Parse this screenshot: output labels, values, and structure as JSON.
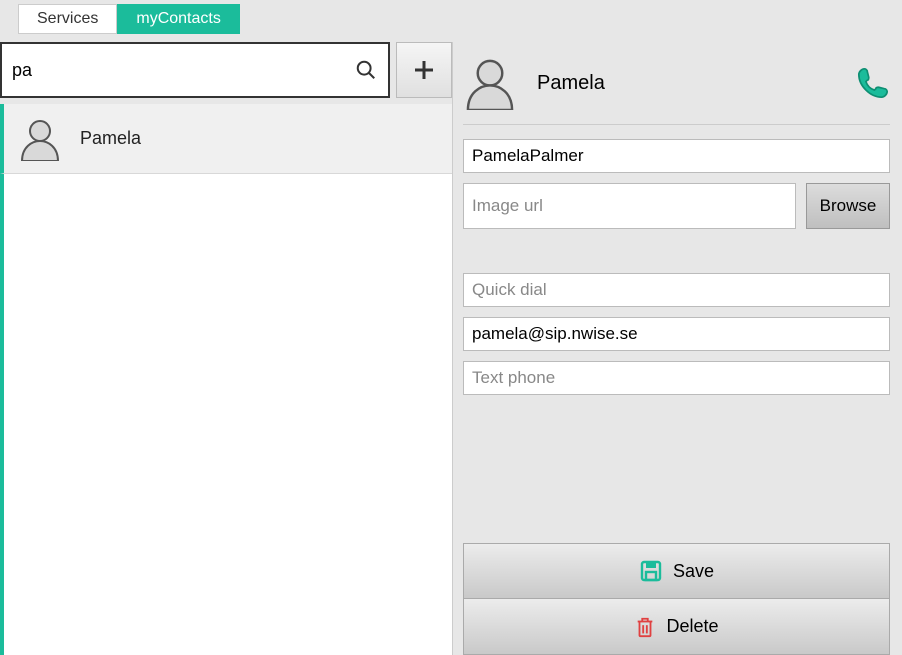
{
  "tabs": {
    "services": "Services",
    "mycontacts": "myContacts"
  },
  "search": {
    "value": "pa"
  },
  "contacts": [
    {
      "name": "Pamela"
    }
  ],
  "detail": {
    "name": "Pamela",
    "fields": {
      "fullname": {
        "value": "PamelaPalmer"
      },
      "image_url": {
        "value": "",
        "placeholder": "Image url"
      },
      "quick_dial": {
        "value": "",
        "placeholder": "Quick dial"
      },
      "sip": {
        "value": "pamela@sip.nwise.se"
      },
      "text_phone": {
        "value": "",
        "placeholder": "Text phone"
      }
    },
    "buttons": {
      "browse": "Browse",
      "save": "Save",
      "delete": "Delete"
    }
  }
}
